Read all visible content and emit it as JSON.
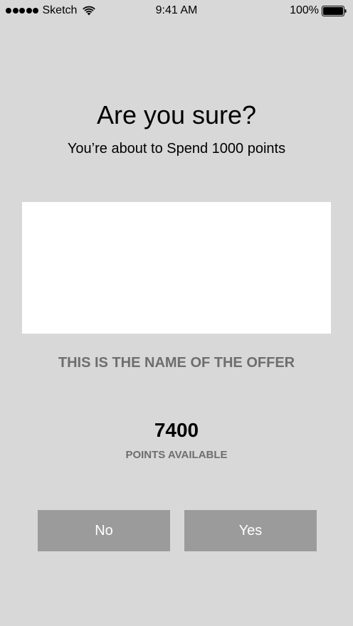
{
  "status_bar": {
    "carrier": "Sketch",
    "time": "9:41 AM",
    "battery_percent": "100%",
    "signal_icon": "signal-dots-icon",
    "wifi_icon": "wifi-icon",
    "battery_icon": "battery-icon",
    "battery_level": 1.0
  },
  "dialog": {
    "title": "Are you sure?",
    "subtitle": "You’re about to Spend 1000 points",
    "offer_name": "THIS IS THE NAME OF THE OFFER",
    "points_value": "7400",
    "points_label": "POINTS AVAILABLE"
  },
  "actions": {
    "no_label": "No",
    "yes_label": "Yes"
  },
  "colors": {
    "background": "#d8d8d8",
    "button": "#9b9b9b",
    "muted_text": "#6e6e6e",
    "image_placeholder": "#ffffff"
  }
}
